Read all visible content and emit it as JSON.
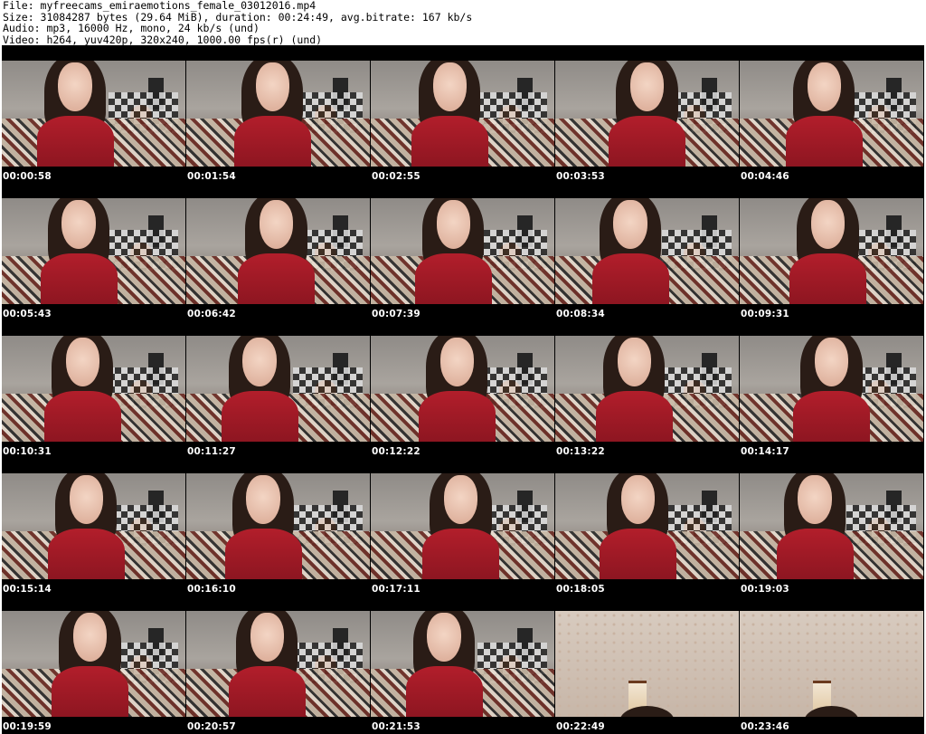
{
  "header": {
    "file_line": "File: myfreecams_emiraemotions_female_03012016.mp4",
    "size_line": "Size: 31084287 bytes (29.64 MiB), duration: 00:24:49, avg.bitrate: 167 kb/s",
    "audio_line": "Audio: mp3, 16000 Hz, mono, 24 kb/s (und)",
    "video_line": "Video: h264, yuv420p, 320x240, 1000.00 fps(r) (und)"
  },
  "thumbnails": [
    {
      "time": "00:00:58",
      "scene": "person"
    },
    {
      "time": "00:01:54",
      "scene": "person"
    },
    {
      "time": "00:02:55",
      "scene": "person"
    },
    {
      "time": "00:03:53",
      "scene": "person"
    },
    {
      "time": "00:04:46",
      "scene": "person"
    },
    {
      "time": "00:05:43",
      "scene": "person"
    },
    {
      "time": "00:06:42",
      "scene": "person"
    },
    {
      "time": "00:07:39",
      "scene": "person"
    },
    {
      "time": "00:08:34",
      "scene": "person"
    },
    {
      "time": "00:09:31",
      "scene": "person"
    },
    {
      "time": "00:10:31",
      "scene": "person"
    },
    {
      "time": "00:11:27",
      "scene": "person"
    },
    {
      "time": "00:12:22",
      "scene": "person"
    },
    {
      "time": "00:13:22",
      "scene": "person"
    },
    {
      "time": "00:14:17",
      "scene": "person"
    },
    {
      "time": "00:15:14",
      "scene": "person"
    },
    {
      "time": "00:16:10",
      "scene": "person"
    },
    {
      "time": "00:17:11",
      "scene": "person"
    },
    {
      "time": "00:18:05",
      "scene": "person"
    },
    {
      "time": "00:19:03",
      "scene": "person"
    },
    {
      "time": "00:19:59",
      "scene": "person"
    },
    {
      "time": "00:20:57",
      "scene": "person"
    },
    {
      "time": "00:21:53",
      "scene": "person"
    },
    {
      "time": "00:22:49",
      "scene": "wall"
    },
    {
      "time": "00:23:46",
      "scene": "wall"
    }
  ]
}
